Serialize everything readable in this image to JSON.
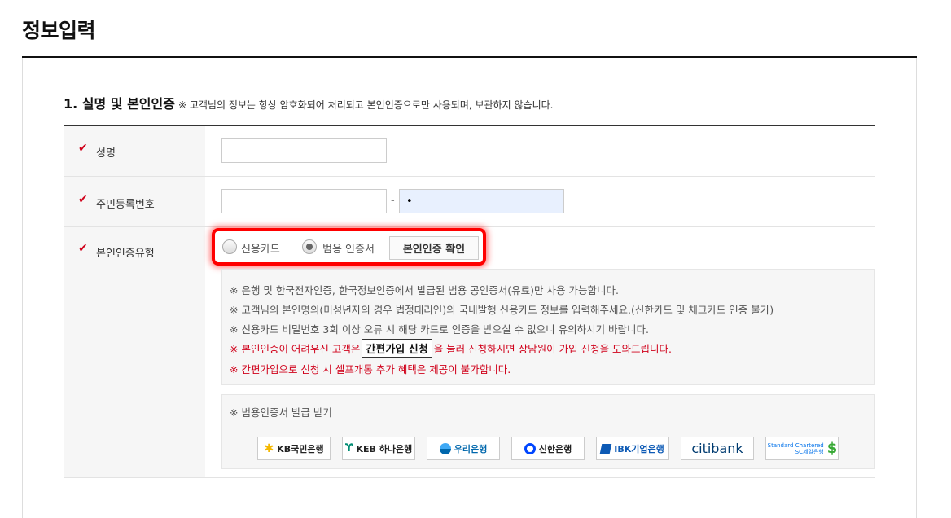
{
  "page": {
    "title": "정보입력"
  },
  "section": {
    "heading": "1. 실명 및 본인인증",
    "note": "※ 고객님의 정보는 항상 암호화되어 처리되고 본인인증으로만 사용되며, 보관하지 않습니다."
  },
  "form": {
    "name": {
      "label": "성명",
      "value": "",
      "placeholder": ""
    },
    "rrn": {
      "label": "주민등록번호",
      "front_value": "",
      "dash": "-",
      "back_value": "•"
    },
    "auth_type": {
      "label": "본인인증유형",
      "options": [
        {
          "label": "신용카드",
          "checked": false
        },
        {
          "label": "범용 인증서",
          "checked": true
        }
      ],
      "verify_button": "본인인증 확인"
    }
  },
  "notices": {
    "line1": "※ 은행 및 한국전자인증, 한국정보인증에서 발급된 범용 공인증서(유료)만 사용 가능합니다.",
    "line2": "※ 고객님의 본인명의(미성년자의 경우 법정대리인)의 국내발행 신용카드 정보를 입력해주세요.(신한카드 및 체크카드 인증 불가)",
    "line3": "※ 신용카드 비밀번호 3회 이상 오류 시 해당 카드로 인증을 받으실 수 없으니 유의하시기 바랍니다.",
    "line4_pre": "※ 본인인증이 어려우신 고객은",
    "line4_button": "간편가입 신청",
    "line4_post": "을 눌러 신청하시면 상담원이 가입 신청을 도와드립니다.",
    "line5": "※ 간편가입으로 신청 시 셀프개통 추가 혜택은 제공이 불가합니다."
  },
  "certificate": {
    "title": "※ 범용인증서 발급 받기",
    "banks": [
      {
        "name": "KB국민은행",
        "icon": "kb-star-icon",
        "color": "#f5b800"
      },
      {
        "name": "KEB 하나은행",
        "icon": "hana-icon",
        "color": "#008c73"
      },
      {
        "name": "우리은행",
        "icon": "woori-icon",
        "color": "#0067ac"
      },
      {
        "name": "신한은행",
        "icon": "shinhan-icon",
        "color": "#0046ff"
      },
      {
        "name": "IBK기업은행",
        "icon": "ibk-icon",
        "color": "#0d5ab5"
      },
      {
        "name": "citibank",
        "icon": "citi-arc-icon",
        "color": "#003b70"
      },
      {
        "name": "Standard Chartered SC제일은행",
        "icon": "sc-icon",
        "color": "#0473ea"
      }
    ]
  },
  "colors": {
    "required_mark": "#d0021b",
    "warning_text": "#d0021b",
    "highlight": "#ff0000"
  }
}
